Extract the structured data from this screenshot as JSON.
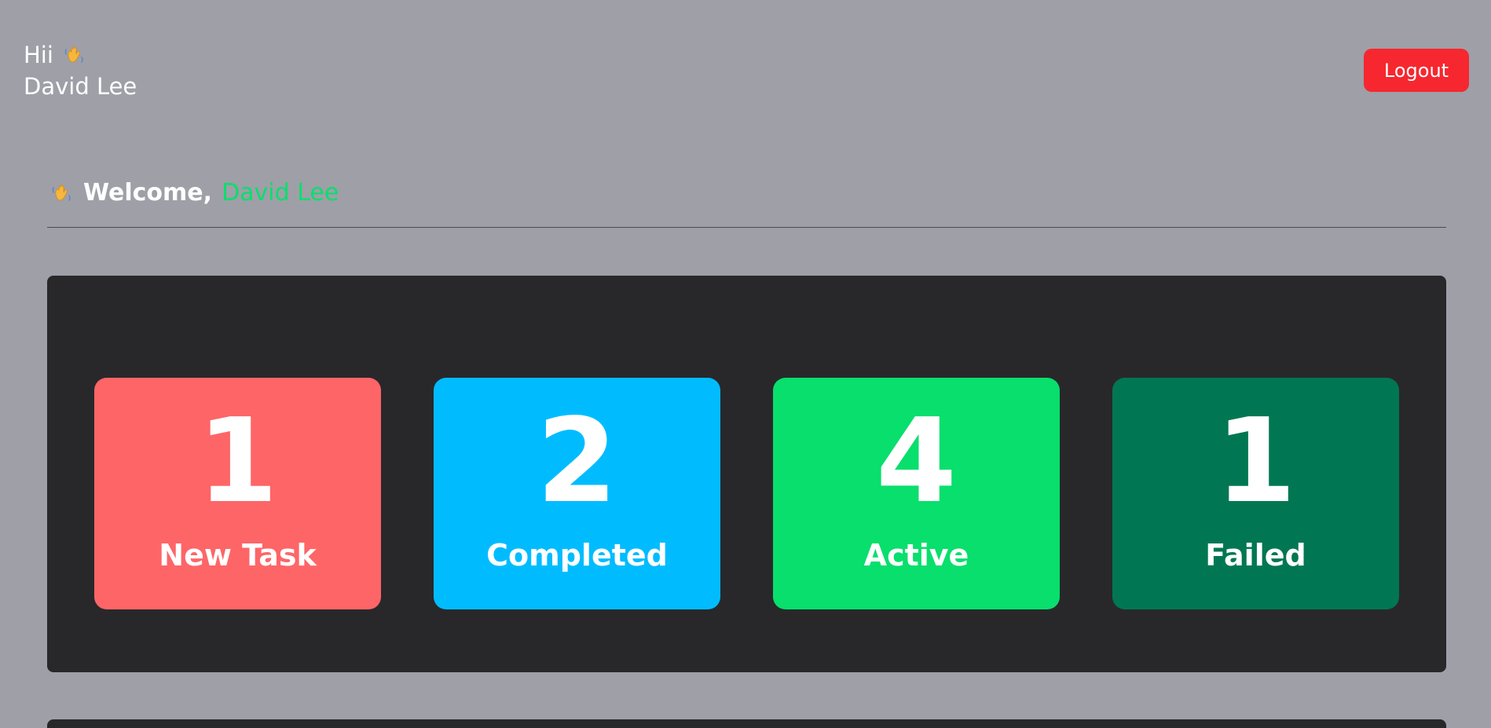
{
  "header": {
    "greeting": "Hii",
    "user_name": "David Lee",
    "logout_label": "Logout"
  },
  "welcome": {
    "prefix": "Welcome,",
    "name": "David Lee"
  },
  "stats": [
    {
      "count": "1",
      "label": "New Task",
      "color": "#fe6567"
    },
    {
      "count": "2",
      "label": "Completed",
      "color": "#00bcff"
    },
    {
      "count": "4",
      "label": "Active",
      "color": "#08df6c"
    },
    {
      "count": "1",
      "label": "Failed",
      "color": "#007752"
    }
  ],
  "icons": {
    "wave": "waving-hand-icon"
  },
  "colors": {
    "background": "#9f9fa8",
    "panel": "#28282b",
    "logout": "#f6272f",
    "accent_name": "#08df6c"
  }
}
